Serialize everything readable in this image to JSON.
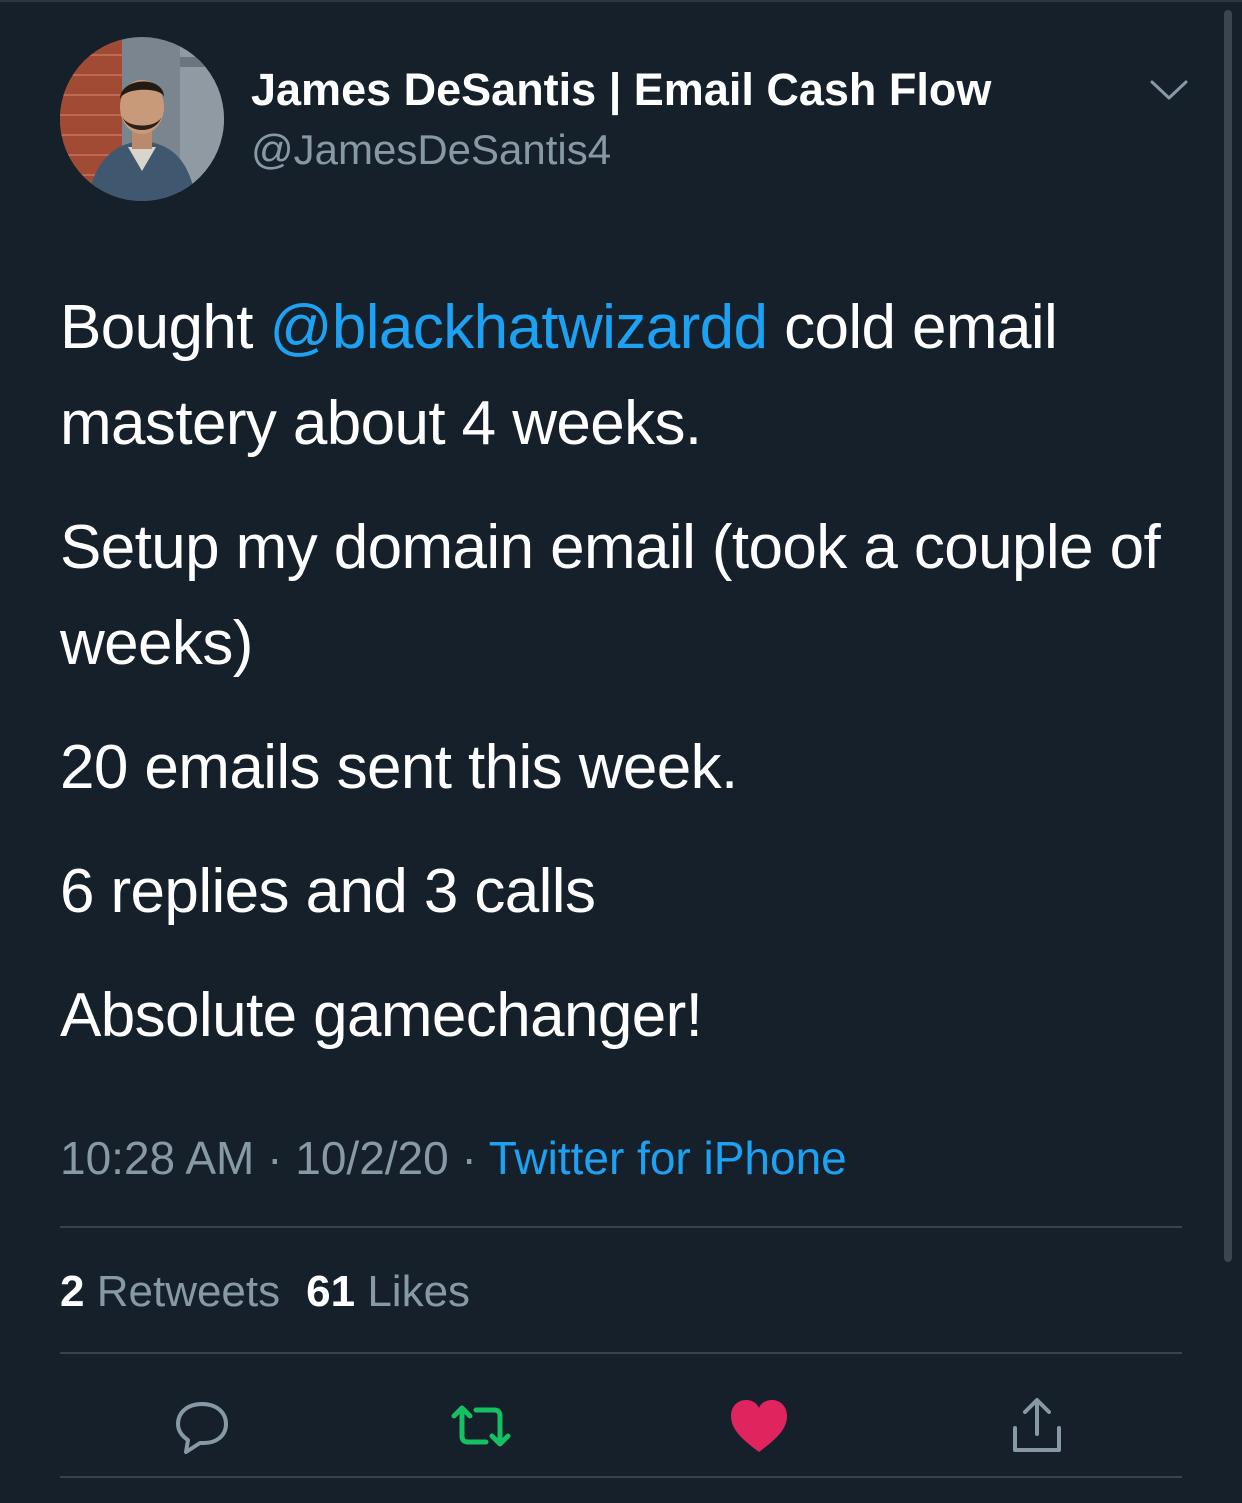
{
  "tweet": {
    "author": {
      "display_name": "James DeSantis | Email Cash Flow",
      "handle": "@JamesDeSantis4"
    },
    "body": {
      "p1_prefix": "Bought ",
      "p1_mention": "@blackhatwizardd",
      "p1_suffix": " cold email mastery about 4 weeks.",
      "p2": "Setup my domain email (took a couple of weeks)",
      "p3": "20 emails sent this week.",
      "p4": "6 replies and 3 calls",
      "p5": "Absolute gamechanger!"
    },
    "meta": {
      "time": "10:28 AM",
      "separator": "·",
      "date": "10/2/20",
      "source": "Twitter for iPhone"
    },
    "stats": {
      "retweets_count": "2",
      "retweets_label": "Retweets",
      "likes_count": "61",
      "likes_label": "Likes"
    },
    "actions": {
      "reply_icon": "reply-icon",
      "retweet_icon": "retweet-icon",
      "like_icon": "heart-icon",
      "share_icon": "share-icon"
    }
  },
  "colors": {
    "background": "#15202b",
    "link": "#1da1f2",
    "muted_text": "#8899a6",
    "retweet_active": "#17bf63",
    "like_active": "#e0245e",
    "divider": "#38444d"
  }
}
